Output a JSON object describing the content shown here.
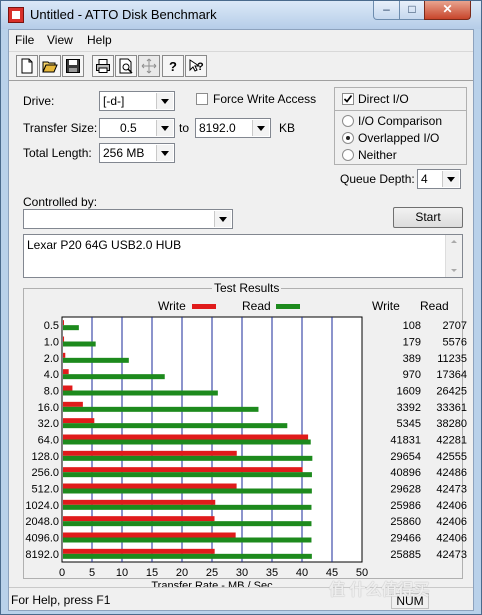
{
  "window": {
    "title": "Untitled - ATTO Disk Benchmark",
    "caption_min": "–",
    "caption_max": "□",
    "caption_close": "✕"
  },
  "menu": {
    "items": [
      "File",
      "View",
      "Help"
    ]
  },
  "toolbar": {
    "icons": [
      "new-icon",
      "open-icon",
      "save-icon",
      "print-icon",
      "print-preview-icon",
      "move-icon",
      "help-icon",
      "context-help-icon"
    ]
  },
  "settings": {
    "drive_label": "Drive:",
    "drive_value": "[-d-]",
    "transfer_size_label": "Transfer Size:",
    "transfer_from": "0.5",
    "transfer_to_label": "to",
    "transfer_to": "8192.0",
    "transfer_unit": "KB",
    "total_length_label": "Total Length:",
    "total_length_value": "256 MB",
    "force_write_label": "Force Write Access",
    "force_write_checked": false,
    "direct_io_label": "Direct I/O",
    "direct_io_checked": true,
    "io_comparison_label": "I/O Comparison",
    "overlapped_io_label": "Overlapped I/O",
    "neither_label": "Neither",
    "selected_mode": "Overlapped I/O",
    "queue_depth_label": "Queue Depth:",
    "queue_depth_value": "4",
    "controlled_by_label": "Controlled by:",
    "controlled_by_value": "",
    "start_label": "Start",
    "description": "Lexar P20 64G USB2.0 HUB"
  },
  "results": {
    "frame_title": "Test Results",
    "legend_write": "Write",
    "legend_read": "Read",
    "col_write": "Write",
    "col_read": "Read"
  },
  "status": {
    "text": "For Help, press F1",
    "num": "NUM"
  },
  "overlay": {
    "watermark": "值 什么值得买"
  },
  "chart_data": {
    "type": "bar",
    "orientation": "horizontal",
    "categories": [
      "0.5",
      "1.0",
      "2.0",
      "4.0",
      "8.0",
      "16.0",
      "32.0",
      "64.0",
      "128.0",
      "256.0",
      "512.0",
      "1024.0",
      "2048.0",
      "4096.0",
      "8192.0"
    ],
    "series": [
      {
        "name": "Write",
        "color": "#e01b1b",
        "values": [
          108,
          179,
          389,
          970,
          1609,
          3392,
          5345,
          41831,
          29654,
          40896,
          29628,
          25986,
          25860,
          29466,
          25885
        ]
      },
      {
        "name": "Read",
        "color": "#1d8a1d",
        "values": [
          2707,
          5576,
          11235,
          17364,
          26425,
          33361,
          38280,
          42281,
          42555,
          42486,
          42473,
          42406,
          42406,
          42406,
          42473
        ]
      }
    ],
    "xlabel": "Transfer Rate - MB / Sec",
    "xticks": [
      "0",
      "5",
      "10",
      "15",
      "20",
      "25",
      "30",
      "35",
      "40",
      "45",
      "50"
    ],
    "xlim": [
      0,
      50
    ],
    "value_unit": "KB/s"
  }
}
